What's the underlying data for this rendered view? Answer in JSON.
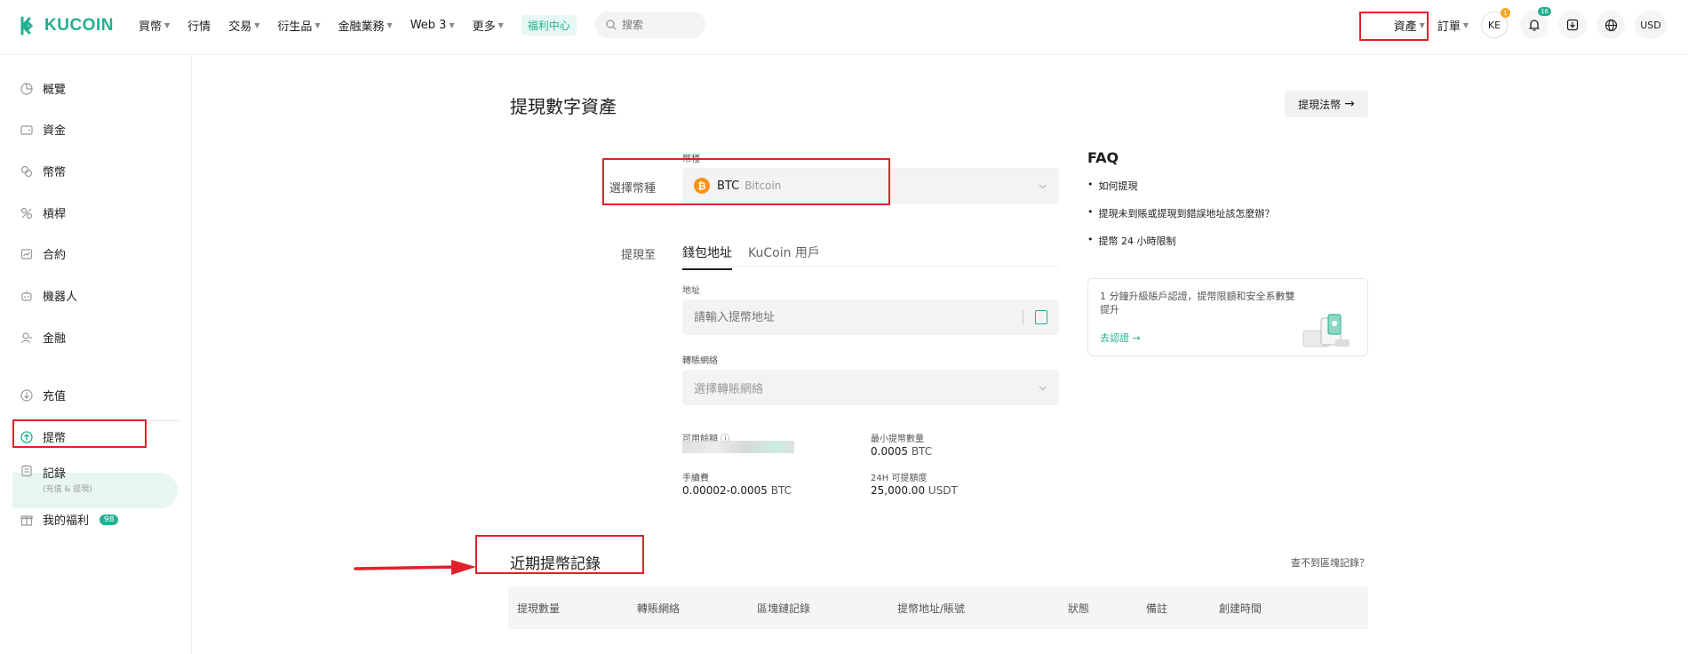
{
  "header": {
    "brand": "KUCOIN",
    "nav": [
      {
        "label": "買幣",
        "caret": true
      },
      {
        "label": "行情",
        "caret": false
      },
      {
        "label": "交易",
        "caret": true
      },
      {
        "label": "衍生品",
        "caret": true
      },
      {
        "label": "金融業務",
        "caret": true
      },
      {
        "label": "Web 3",
        "caret": true
      },
      {
        "label": "更多",
        "caret": true
      }
    ],
    "promo_badge": "福利中心",
    "search_placeholder": "搜索",
    "assets": "資產",
    "orders": "訂單",
    "avatar": "KE",
    "avatar_badge": "1",
    "notif_count": "16",
    "currency": "USD"
  },
  "sidebar": {
    "items": [
      {
        "label": "概覽",
        "icon": "overview-icon"
      },
      {
        "label": "資金",
        "icon": "wallet-icon"
      },
      {
        "label": "幣幣",
        "icon": "spot-icon"
      },
      {
        "label": "槓桿",
        "icon": "margin-icon"
      },
      {
        "label": "合約",
        "icon": "futures-icon"
      },
      {
        "label": "機器人",
        "icon": "bot-icon"
      },
      {
        "label": "金融",
        "icon": "finance-icon"
      },
      {
        "label": "充值",
        "icon": "deposit-icon"
      },
      {
        "label": "提幣",
        "icon": "withdraw-icon"
      },
      {
        "label": "記錄",
        "sub": "(充值 & 提現)",
        "icon": "history-icon"
      },
      {
        "label": "我的福利",
        "badge": "98",
        "icon": "gift-icon"
      }
    ]
  },
  "main": {
    "title": "提現數字資產",
    "fiat_button": "提現法幣",
    "coin_section_label": "選擇幣種",
    "coin_field_label": "幣種",
    "coin_symbol": "BTC",
    "coin_name": "Bitcoin",
    "withdraw_to_label": "提現至",
    "tabs": [
      "錢包地址",
      "KuCoin 用戶"
    ],
    "address_label": "地址",
    "address_placeholder": "請輸入提幣地址",
    "network_label": "轉賬網絡",
    "network_placeholder": "選擇轉賬網絡",
    "available_label": "可用餘額",
    "min_label": "最小提幣數量",
    "min_value": "0.0005",
    "min_unit": "BTC",
    "fee_label": "手續費",
    "fee_value": "0.00002-0.0005",
    "fee_unit": "BTC",
    "limit_label": "24H 可提額度",
    "limit_value": "25,000.00",
    "limit_unit": "USDT"
  },
  "faq": {
    "title": "FAQ",
    "items": [
      "如何提現",
      "提現未到賬或提現到錯誤地址該怎麼辦？",
      "提幣 24 小時限制"
    ],
    "promo_text": "1 分鐘升級賬戶認證，提幣限額和安全系數雙提升",
    "promo_link": "去認證 →"
  },
  "recent": {
    "title": "近期提幣記錄",
    "link": "查不到區塊記錄？",
    "columns": [
      "提現數量",
      "轉賬網絡",
      "區塊鏈記錄",
      "提幣地址/賬號",
      "狀態",
      "備註",
      "創建時間"
    ]
  },
  "colors": {
    "accent": "#23af91",
    "highlight": "#e0202a",
    "btc": "#f7931a"
  }
}
